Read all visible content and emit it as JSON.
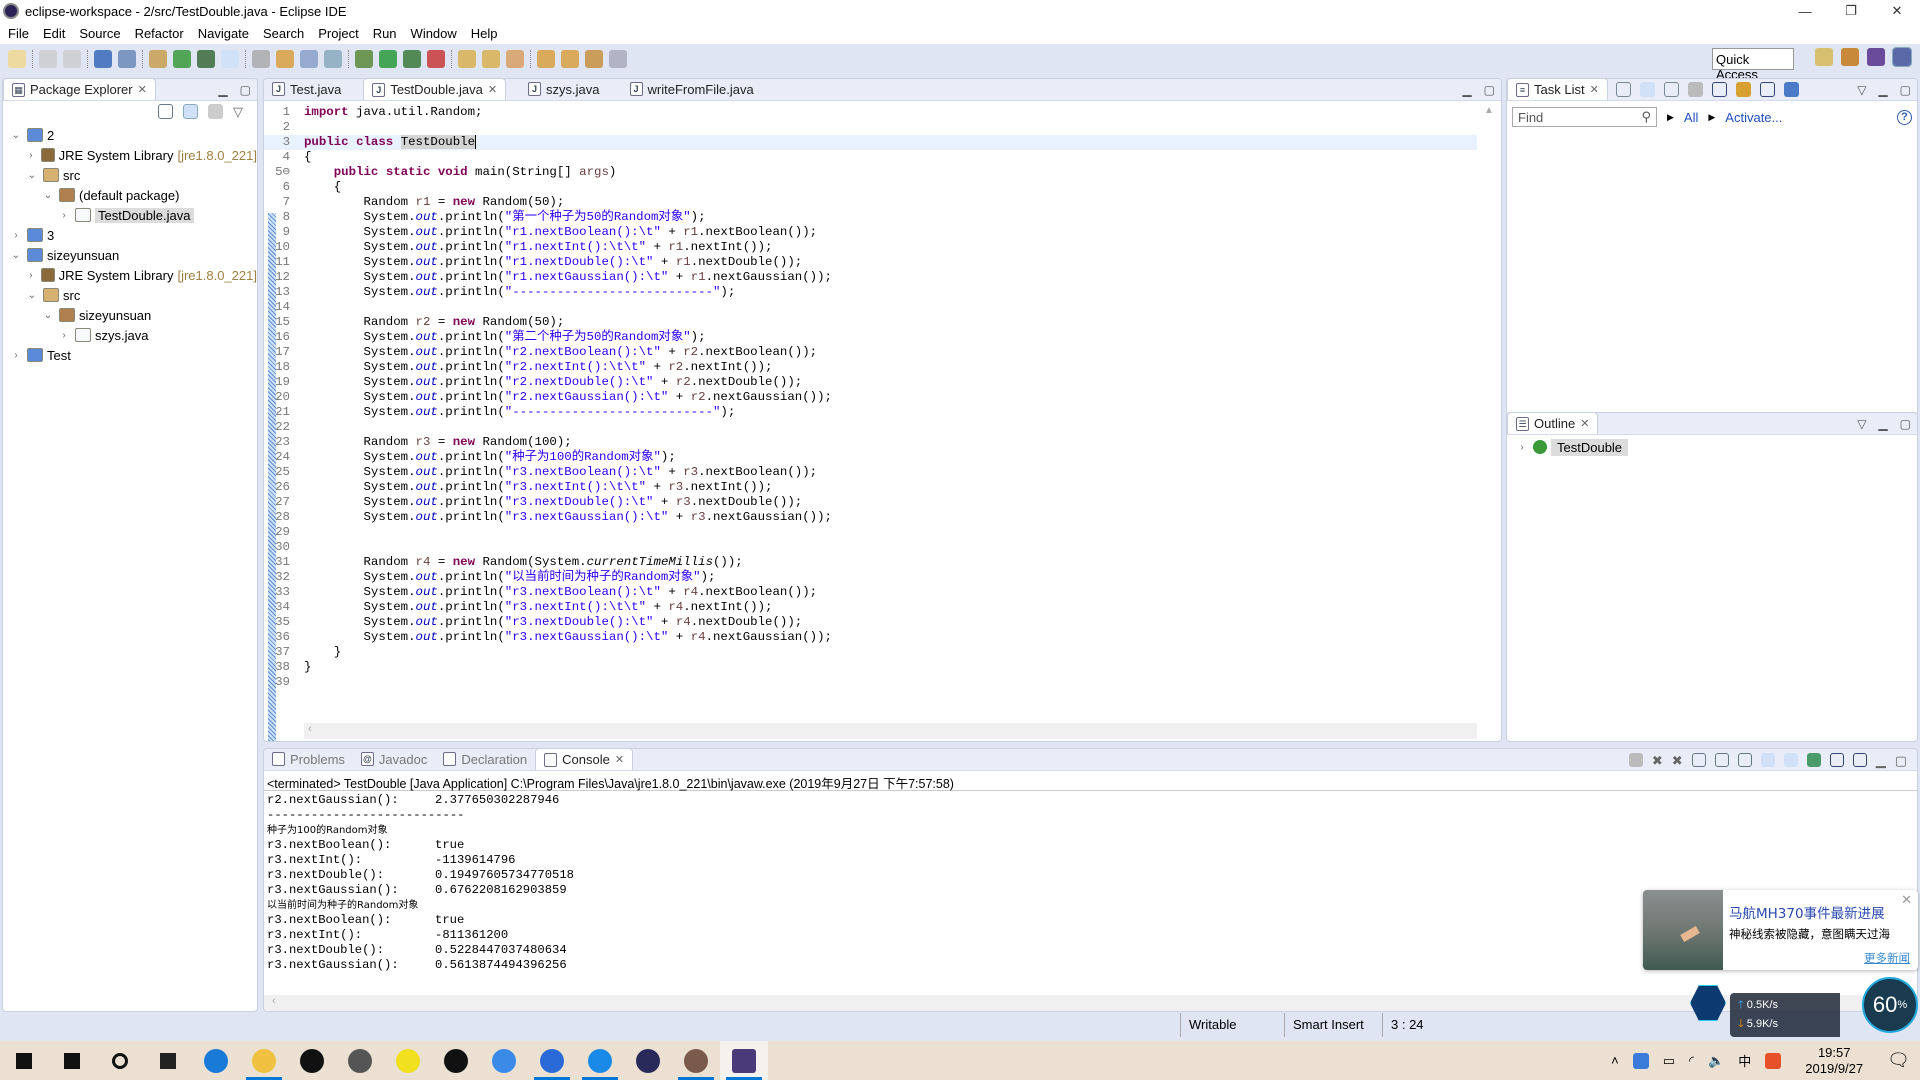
{
  "window": {
    "title": "eclipse-workspace - 2/src/TestDouble.java - Eclipse IDE",
    "controls": [
      "—",
      "❐",
      "✕"
    ]
  },
  "menu": [
    "File",
    "Edit",
    "Source",
    "Refactor",
    "Navigate",
    "Search",
    "Project",
    "Run",
    "Window",
    "Help"
  ],
  "toolbar": {
    "quick_access": "Quick Access"
  },
  "package_explorer": {
    "title": "Package Explorer",
    "tree": [
      {
        "level": 0,
        "expanded": true,
        "label": "2",
        "icon": "project-icon"
      },
      {
        "level": 1,
        "expanded": false,
        "label": "JRE System Library",
        "suffix": "[jre1.8.0_221]",
        "icon": "library-icon"
      },
      {
        "level": 1,
        "expanded": true,
        "label": "src",
        "icon": "source-folder-icon"
      },
      {
        "level": 2,
        "expanded": true,
        "label": "(default package)",
        "icon": "package-icon"
      },
      {
        "level": 3,
        "expanded": false,
        "label": "TestDouble.java",
        "icon": "java-file-icon",
        "selected": true
      },
      {
        "level": 0,
        "expanded": false,
        "label": "3",
        "icon": "project-icon"
      },
      {
        "level": 0,
        "expanded": true,
        "label": "sizeyunsuan",
        "icon": "project-icon"
      },
      {
        "level": 1,
        "expanded": false,
        "label": "JRE System Library",
        "suffix": "[jre1.8.0_221]",
        "icon": "library-icon"
      },
      {
        "level": 1,
        "expanded": true,
        "label": "src",
        "icon": "source-folder-icon"
      },
      {
        "level": 2,
        "expanded": true,
        "label": "sizeyunsuan",
        "icon": "package-icon"
      },
      {
        "level": 3,
        "expanded": false,
        "label": "szys.java",
        "icon": "java-file-icon"
      },
      {
        "level": 0,
        "expanded": false,
        "label": "Test",
        "icon": "project-icon"
      }
    ]
  },
  "editor": {
    "tabs": [
      {
        "label": "Test.java"
      },
      {
        "label": "TestDouble.java",
        "active": true
      },
      {
        "label": "szys.java"
      },
      {
        "label": "writeFromFile.java"
      }
    ],
    "lines": [
      "import java.util.Random;",
      "",
      "public class TestDouble",
      "{",
      "    public static void main(String[] args)",
      "    {",
      "        Random r1 = new Random(50);",
      "        System.out.println(\"第一个种子为50的Random对象\");",
      "        System.out.println(\"r1.nextBoolean():\\t\" + r1.nextBoolean());",
      "        System.out.println(\"r1.nextInt():\\t\\t\" + r1.nextInt());",
      "        System.out.println(\"r1.nextDouble():\\t\" + r1.nextDouble());",
      "        System.out.println(\"r1.nextGaussian():\\t\" + r1.nextGaussian());",
      "        System.out.println(\"---------------------------\");",
      "",
      "        Random r2 = new Random(50);",
      "        System.out.println(\"第二个种子为50的Random对象\");",
      "        System.out.println(\"r2.nextBoolean():\\t\" + r2.nextBoolean());",
      "        System.out.println(\"r2.nextInt():\\t\\t\" + r2.nextInt());",
      "        System.out.println(\"r2.nextDouble():\\t\" + r2.nextDouble());",
      "        System.out.println(\"r2.nextGaussian():\\t\" + r2.nextGaussian());",
      "        System.out.println(\"---------------------------\");",
      "",
      "        Random r3 = new Random(100);",
      "        System.out.println(\"种子为100的Random对象\");",
      "        System.out.println(\"r3.nextBoolean():\\t\" + r3.nextBoolean());",
      "        System.out.println(\"r3.nextInt():\\t\\t\" + r3.nextInt());",
      "        System.out.println(\"r3.nextDouble():\\t\" + r3.nextDouble());",
      "        System.out.println(\"r3.nextGaussian():\\t\" + r3.nextGaussian());",
      "",
      "",
      "        Random r4 = new Random(System.currentTimeMillis());",
      "        System.out.println(\"以当前时间为种子的Random对象\");",
      "        System.out.println(\"r3.nextBoolean():\\t\" + r4.nextBoolean());",
      "        System.out.println(\"r3.nextInt():\\t\\t\" + r4.nextInt());",
      "        System.out.println(\"r3.nextDouble():\\t\" + r4.nextDouble());",
      "        System.out.println(\"r3.nextGaussian():\\t\" + r4.nextGaussian());",
      "    }",
      "}",
      ""
    ],
    "current_line": 3
  },
  "task_list": {
    "title": "Task List",
    "find_placeholder": "Find",
    "all": "All",
    "activate": "Activate..."
  },
  "outline": {
    "title": "Outline",
    "items": [
      "TestDouble"
    ]
  },
  "bottom": {
    "tabs": [
      {
        "label": "Problems"
      },
      {
        "label": "Javadoc"
      },
      {
        "label": "Declaration"
      },
      {
        "label": "Console",
        "active": true
      }
    ],
    "console_header": "<terminated> TestDouble [Java Application] C:\\Program Files\\Java\\jre1.8.0_221\\bin\\javaw.exe (2019年9月27日 下午7:57:58)",
    "output": [
      {
        "label": "r2.nextGaussian():",
        "value": "2.377650302287946"
      },
      {
        "label": "---------------------------"
      },
      {
        "label": "种子为100的Random对象",
        "cn": true
      },
      {
        "label": "r3.nextBoolean():",
        "value": "true"
      },
      {
        "label": "r3.nextInt():",
        "value": "-1139614796"
      },
      {
        "label": "r3.nextDouble():",
        "value": "0.19497605734770518"
      },
      {
        "label": "r3.nextGaussian():",
        "value": "0.6762208162903859"
      },
      {
        "label": "以当前时间为种子的Random对象",
        "cn": true
      },
      {
        "label": "r3.nextBoolean():",
        "value": "true"
      },
      {
        "label": "r3.nextInt():",
        "value": "-811361200"
      },
      {
        "label": "r3.nextDouble():",
        "value": "0.5228447037480634"
      },
      {
        "label": "r3.nextGaussian():",
        "value": "0.5613874494396256"
      }
    ]
  },
  "status": {
    "writable": "Writable",
    "insert_mode": "Smart Insert",
    "position": "3 : 24"
  },
  "notification": {
    "title": "马航MH370事件最新进展",
    "subtitle": "神秘线索被隐藏，意图瞒天过海",
    "more": "更多新闻"
  },
  "speed_widget": {
    "up": "0.5K/s",
    "down": "5.9K/s",
    "percent": "60",
    "unit": "%"
  },
  "taskbar": {
    "apps": [
      "start-icon",
      "search-icon",
      "cortana-icon",
      "task-view-icon",
      "edge-icon",
      "file-explorer-icon",
      "store-icon",
      "mail-icon",
      "qq-music-icon",
      "qq-icon",
      "sogou-browser-icon",
      "wps-icon",
      "uplay-icon",
      "eclipse-icon",
      "avatar-app-icon",
      "java-ee-ide-icon"
    ],
    "time": "19:57",
    "date": "2019/9/27",
    "ime": "中"
  }
}
